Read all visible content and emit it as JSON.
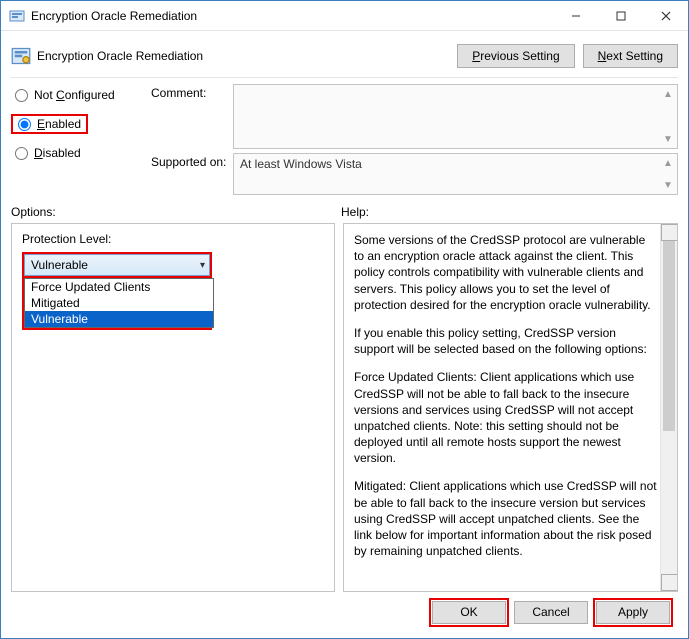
{
  "window": {
    "title": "Encryption Oracle Remediation",
    "header_title": "Encryption Oracle Remediation"
  },
  "nav": {
    "previous": "Previous Setting",
    "next": "Next Setting"
  },
  "radios": {
    "not_configured": "Not Configured",
    "enabled": "Enabled",
    "disabled": "Disabled",
    "selected": "enabled"
  },
  "fields": {
    "comment_label": "Comment:",
    "comment_value": "",
    "supported_label": "Supported on:",
    "supported_value": "At least Windows Vista"
  },
  "labels": {
    "options": "Options:",
    "help": "Help:"
  },
  "options": {
    "protection_label": "Protection Level:",
    "selected_value": "Vulnerable",
    "items": {
      "0": "Force Updated Clients",
      "1": "Mitigated",
      "2": "Vulnerable"
    }
  },
  "help": {
    "p1": "Some versions of the CredSSP protocol are vulnerable to an encryption oracle attack against the client.  This policy controls compatibility with vulnerable clients and servers.  This policy allows you to set the level of protection desired for the encryption oracle vulnerability.",
    "p2": "If you enable this policy setting, CredSSP version support will be selected based on the following options:",
    "p3": "Force Updated Clients: Client applications which use CredSSP will not be able to fall back to the insecure versions and services using CredSSP will not accept unpatched clients. Note: this setting should not be deployed until all remote hosts support the newest version.",
    "p4": "Mitigated: Client applications which use CredSSP will not be able to fall back to the insecure version but services using CredSSP will accept unpatched clients. See the link below for important information about the risk posed by remaining unpatched clients."
  },
  "footer": {
    "ok": "OK",
    "cancel": "Cancel",
    "apply": "Apply"
  }
}
